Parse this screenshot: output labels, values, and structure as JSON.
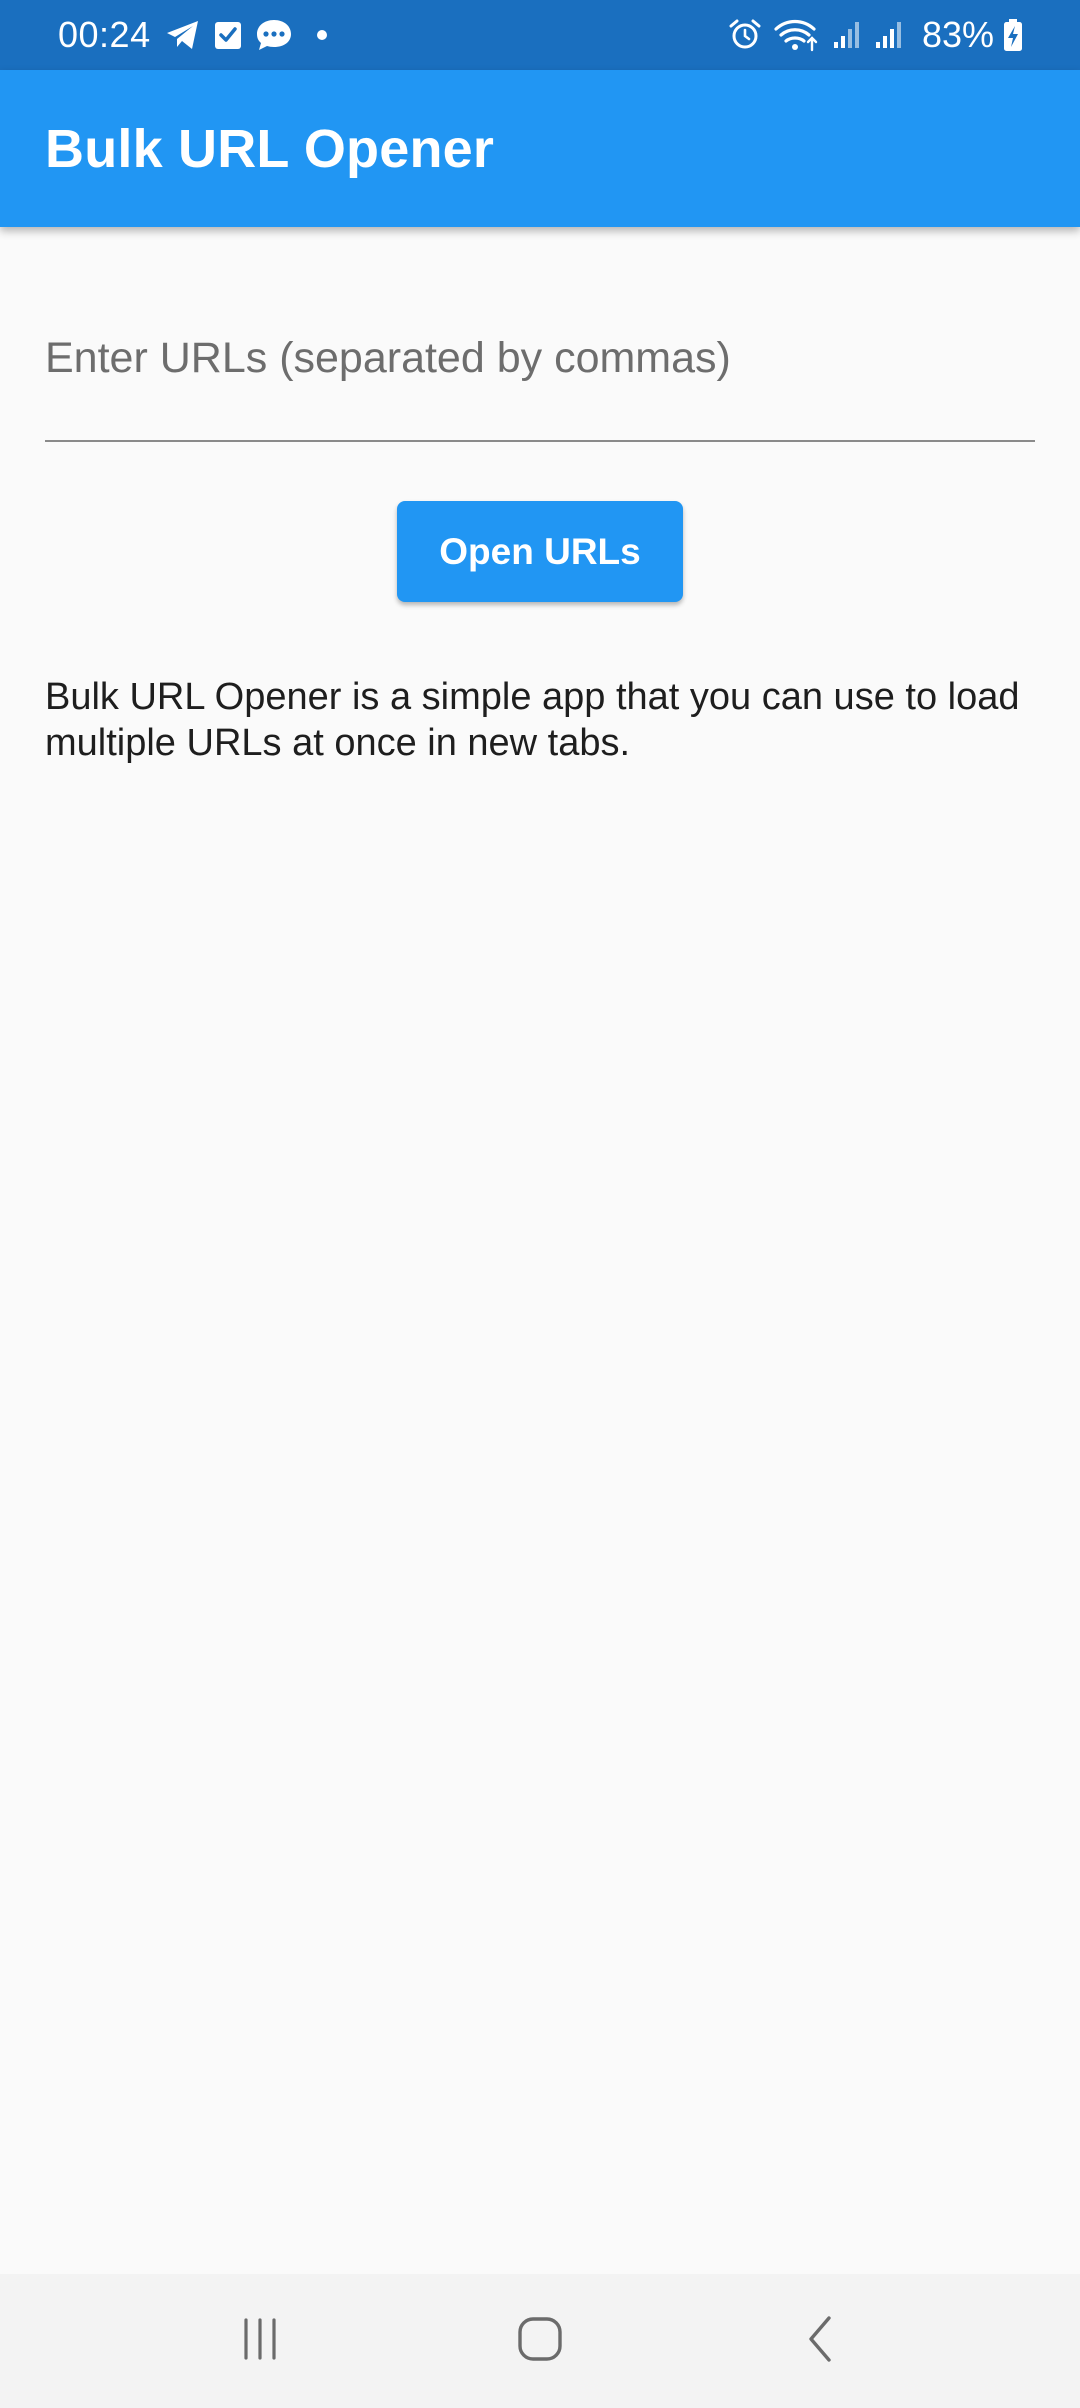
{
  "status_bar": {
    "time": "00:24",
    "battery_percent": "83%",
    "left_icons": [
      "telegram-icon",
      "task-check-icon",
      "chat-bubble-icon",
      "notification-dot-icon"
    ],
    "right_icons": [
      "alarm-icon",
      "wifi-icon",
      "signal-icon",
      "signal-icon",
      "battery-charging-icon"
    ]
  },
  "app_bar": {
    "title": "Bulk URL Opener",
    "color": "#2196f3"
  },
  "form": {
    "url_input": {
      "value": "",
      "placeholder": "Enter URLs (separated by commas)"
    },
    "open_button_label": "Open URLs"
  },
  "description": "Bulk URL Opener is a simple app that you can use to load multiple URLs at once in new tabs.",
  "nav_bar": {
    "buttons": [
      "recent-apps-icon",
      "home-icon",
      "back-icon"
    ]
  }
}
